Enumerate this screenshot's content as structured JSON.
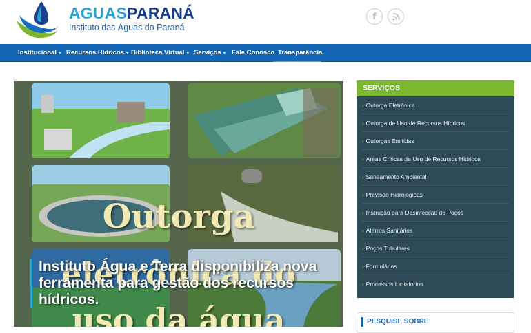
{
  "brand": {
    "title_part1": "AGUAS",
    "title_part2": "PARANÁ",
    "subtitle": "Instituto das Águas do Paraná"
  },
  "social": {
    "facebook_glyph": "f",
    "rss_glyph": "◠"
  },
  "nav": {
    "items": [
      {
        "label": "Institucional",
        "caret": "▾"
      },
      {
        "label": "Recursos Hídricos",
        "caret": "▾"
      },
      {
        "label": "Biblioteca Virtual",
        "caret": "▾"
      },
      {
        "label": "Serviços",
        "caret": "▾"
      },
      {
        "label": "Fale Conosco",
        "caret": ""
      },
      {
        "label": "Transparência",
        "caret": ""
      }
    ]
  },
  "hero": {
    "overlay_line1": "Outorga",
    "overlay_line2": "eletrônica do",
    "overlay_line3": "uso da água",
    "caption": "Instituto Água e Terra disponibiliza nova ferramenta para gestão dos recursos hídricos."
  },
  "services": {
    "title": "SERVIÇOS",
    "items": [
      "Outorga Eletrônica",
      "Outorga de Uso de Recursos Hídricos",
      "Outorgas Emitidas",
      "Áreas Críticas de Uso de Recursos Hídricos",
      "Saneamento Ambiental",
      "Previsão Hidrológicas",
      "Instrução para Desinfecção de Poços",
      "Aterros Sanitários",
      "Poços Tubulares",
      "Formulários",
      "Processos Licitatórios"
    ]
  },
  "search_box": {
    "title": "PESQUISE SOBRE"
  },
  "colors": {
    "nav_blue": "#1466b5",
    "brand_light": "#2aa3d6",
    "brand_dark": "#1b3f8f",
    "services_bg": "#2e4a57",
    "services_header": "#7cb82f"
  }
}
